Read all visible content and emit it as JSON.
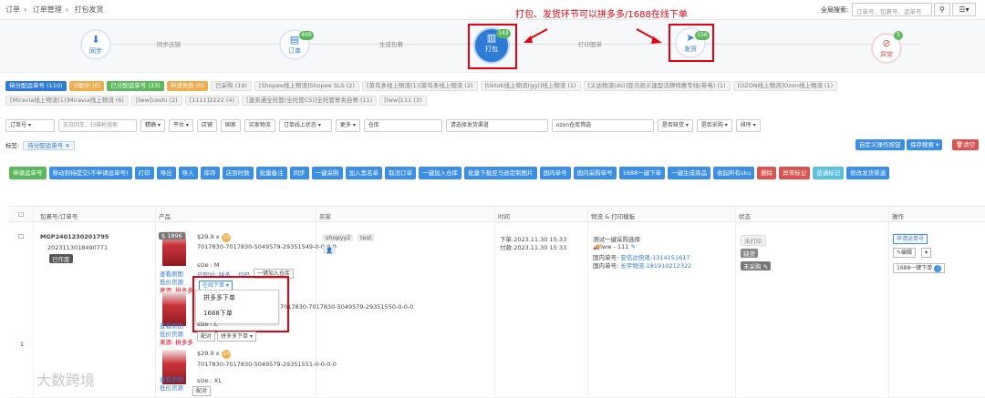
{
  "breadcrumb": [
    "订单",
    "订单管理",
    "打包发货"
  ],
  "breadcrumb_sep": "›",
  "global_search": {
    "label": "全局搜索:",
    "placeholder": "订单号、包裹号、运单号"
  },
  "annotation": "打包、发货环节可以拼多多/1688在线下单",
  "workflow": {
    "steps": [
      {
        "label": "同步",
        "badge": ""
      },
      {
        "label": "订单",
        "badge": "499"
      },
      {
        "label": "打包",
        "badge": "143"
      },
      {
        "label": "发货",
        "badge": "156"
      },
      {
        "label": "异常",
        "badge": "5"
      }
    ],
    "links": [
      "同步店铺",
      "生成包裹",
      "打印面单"
    ]
  },
  "status_tabs": [
    {
      "label": "待分配运单号 (110)",
      "color": "#2e7bd6"
    },
    {
      "label": "分配中 (0)",
      "color": "#f0ad4e"
    },
    {
      "label": "已分配运单号 (33)",
      "color": "#5cb85c"
    },
    {
      "label": "申请失败 (0)",
      "color": "#f0ad4e"
    }
  ],
  "channel_tabs_1": [
    "已采购 (19)",
    "[Shopee线上物流]Shopee SLS (2)",
    "[菜鸟多线上物流(1)]菜鸟多线上物流 (2)",
    "[tiktok线上物流(gg)]线上物流 (1)",
    "[义达物流(ds)]亚马逊义速型法牌特惠专线(带电) (1)",
    "[OZON线上物流]Ozon线上物流 (1)"
  ],
  "channel_tabs_2": [
    "[Miravia线上物流(1)]Miravia线上物流 (6)",
    "[lww]ceshi (2)",
    "[1111]2222 (4)",
    "[速卖通全托管(全托管CS)]全托管寄卖自寄 (11)",
    "[lww]111 (3)"
  ],
  "filters": [
    "订单号",
    "支持回车、扫描枪搜索",
    "精确",
    "平台",
    "店铺",
    "国家",
    "买家物流",
    "订单线上状态",
    "更多",
    "仓库",
    "请选择发货渠道",
    "ozon仓库筛选",
    "是否缺货",
    "是否采购",
    "排序"
  ],
  "tag_label": "标签:",
  "tag_chip": "待分配运单号",
  "right_buttons": [
    "自定义操作按钮",
    "保存搜索",
    "清空"
  ],
  "actions": [
    "申请运单号",
    "移动到待提交(不申请运单号)",
    "打印",
    "导出",
    "导入",
    "库存",
    "店到时数",
    "批量备注",
    "同步",
    "一键采购",
    "加入黑名单",
    "取消订单",
    "一键加入仓库",
    "批量下载亚马逊定制图片",
    "国内单号",
    "国内采购单号",
    "1688一键下单",
    "一键生成商品",
    "收起所有sku",
    "删除",
    "异常标记",
    "普通标记",
    "修改发货渠道"
  ],
  "columns": [
    "包裹号/订单号",
    "产品",
    "买家",
    "时间",
    "物流 & 打印模板",
    "状态",
    "操作"
  ],
  "row": {
    "index": "1",
    "package_no": "MGP2401230201795",
    "order_no": "2023113018490771",
    "order_state": "已作废",
    "price_tag": "$ 1896",
    "items": [
      {
        "price": "$29.9 x",
        "qty": "10",
        "sku": "7017830-7017830-5049579-29351549-0-0-0-0",
        "size": "size : M"
      },
      {
        "price": "",
        "qty": "",
        "sku": "7017830-7017830-5049579-29351550-0-0-0",
        "size": "size : L"
      },
      {
        "price": "$29.9 x",
        "qty": "10",
        "sku": "7017830-7017830-5049579-29351551-0-0-0-0",
        "size": "size : XL"
      }
    ],
    "view_image": "查看原图",
    "low_price": "低价货源",
    "source": "来源: 拼多多",
    "paired": "配对",
    "pdd_order": "拼多多下单",
    "online_order": "在线下单",
    "matched": "已配对: 拼多... 均码",
    "join_warehouse": "一键加入仓库",
    "buyer_tags": [
      "shopyy2",
      "test"
    ],
    "order_time": "下单:2023.11.30 15:33",
    "pay_time": "付款:2023.11.30 15:33",
    "logistics": "测试一键采购选择",
    "carrier": "lww - 111",
    "domestic1_label": "国内单号:",
    "domestic1": "安信达快递-1314151617",
    "domestic2_label": "国内单号:",
    "domestic2": "长宇物流-181910212322",
    "statuses": [
      "未打印",
      "缺货",
      "未采购"
    ],
    "op_buttons": [
      "申请运单号",
      "编辑",
      "1688一键下单"
    ]
  },
  "dropdown": [
    "拼多多下单",
    "1688下单"
  ],
  "watermark": "大数跨境"
}
